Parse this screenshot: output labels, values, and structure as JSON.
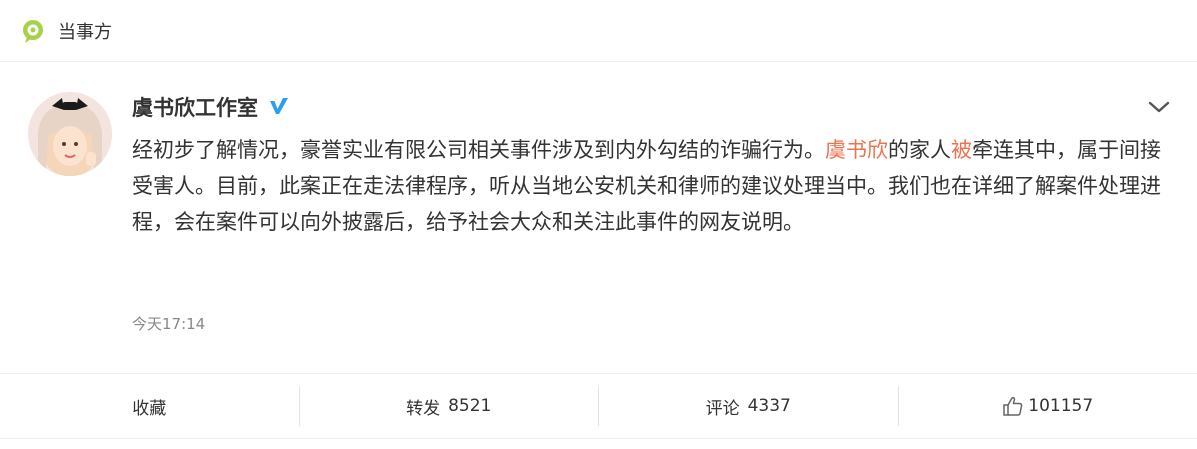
{
  "topbar": {
    "label": "当事方",
    "icon": "location-pin-icon",
    "icon_color": "#9acd32"
  },
  "post": {
    "author": "虞书欣工作室",
    "verified_icon": "verified-badge-icon",
    "verified_color": "#2c9ef0",
    "content": {
      "seg1": "经初步了解情况，豪誉实业有限公司相关事件涉及到内外勾结的诈骗行为。",
      "hl1": "虞书欣",
      "seg2": "的家人",
      "hl2": "被",
      "seg3": "牵连其中，属于间接受害人。目前，此案正在走法律程序，听从当地公安机关和律师的建议处理当中。我们也在详细了解案件处理进程，会在案件可以向外披露后，给予社会大众和关注此事件的网友说明。"
    },
    "highlight_color": "#eb7350",
    "timestamp": "今天17:14"
  },
  "actions": {
    "favorite": {
      "label": "收藏"
    },
    "repost": {
      "label": "转发",
      "count": "8521"
    },
    "comment": {
      "label": "评论",
      "count": "4337"
    },
    "like": {
      "count": "101157",
      "icon": "thumbs-up-icon"
    }
  }
}
